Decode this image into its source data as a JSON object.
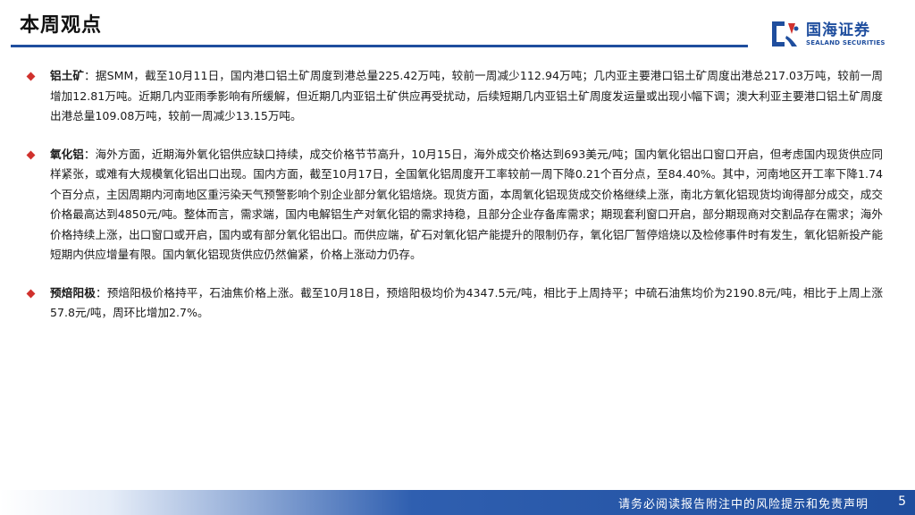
{
  "header": {
    "title": "本周观点",
    "logo_cn": "国海证券",
    "logo_en": "SEALAND SECURITIES"
  },
  "bullets": [
    {
      "key": "铝土矿",
      "text": "：据SMM，截至10月11日，国内港口铝土矿周度到港总量225.42万吨，较前一周减少112.94万吨；几内亚主要港口铝土矿周度出港总217.03万吨，较前一周增加12.81万吨。近期几内亚雨季影响有所缓解，但近期几内亚铝土矿供应再受扰动，后续短期几内亚铝土矿周度发运量或出现小幅下调；澳大利亚主要港口铝土矿周度出港总量109.08万吨，较前一周减少13.15万吨。"
    },
    {
      "key": "氧化铝",
      "text": "：海外方面，近期海外氧化铝供应缺口持续，成交价格节节高升，10月15日，海外成交价格达到693美元/吨；国内氧化铝出口窗口开启，但考虑国内现货供应同样紧张，或难有大规模氧化铝出口出现。国内方面，截至10月17日，全国氧化铝周度开工率较前一周下降0.21个百分点，至84.40%。其中，河南地区开工率下降1.74个百分点，主因周期内河南地区重污染天气预警影响个别企业部分氧化铝焙烧。现货方面，本周氧化铝现货成交价格继续上涨，南北方氧化铝现货均询得部分成交，成交价格最高达到4850元/吨。整体而言，需求端，国内电解铝生产对氧化铝的需求持稳，且部分企业存备库需求；期现套利窗口开启，部分期现商对交割品存在需求；海外价格持续上涨，出口窗口或开启，国内或有部分氧化铝出口。而供应端，矿石对氧化铝产能提升的限制仍存，氧化铝厂暂停焙烧以及检修事件时有发生，氧化铝新投产能短期内供应增量有限。国内氧化铝现货供应仍然偏紧，价格上涨动力仍存。"
    },
    {
      "key": "预焙阳极",
      "text": "：预焙阳极价格持平，石油焦价格上涨。截至10月18日，预焙阳极均价为4347.5元/吨，相比于上周持平；中硫石油焦均价为2190.8元/吨，相比于上周上涨57.8元/吨，周环比增加2.7%。"
    }
  ],
  "footer": {
    "disclaimer": "请务必阅读报告附注中的风险提示和免责声明",
    "page_number": "5"
  },
  "colors": {
    "brand_blue": "#1f4e9e",
    "bullet_red": "#d0312d"
  }
}
